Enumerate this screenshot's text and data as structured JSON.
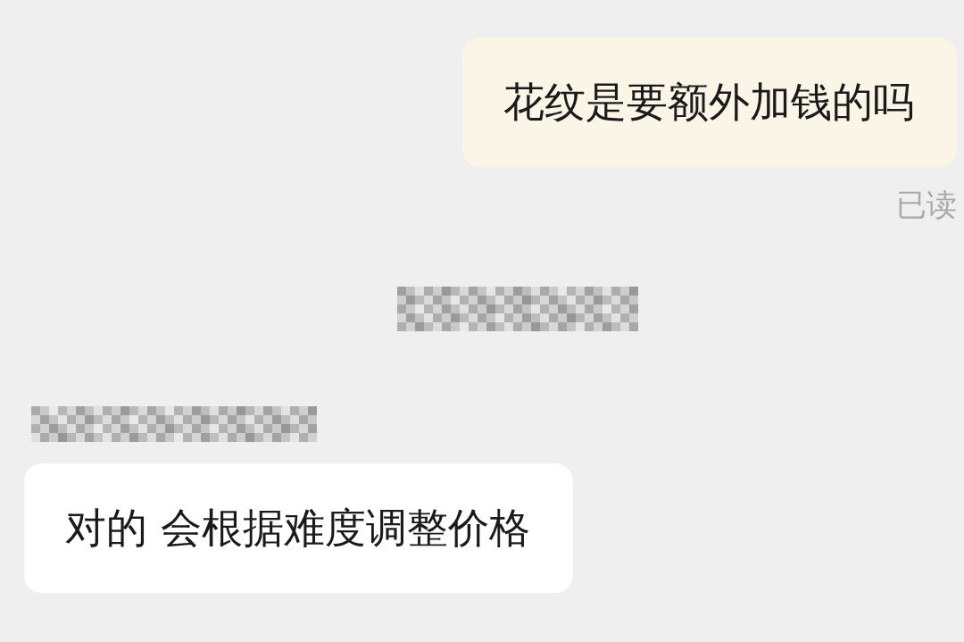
{
  "items": [
    {
      "kind": "sent",
      "text": "花纹是要额外加钱的吗",
      "receipt": "已读"
    },
    {
      "kind": "redacted-timestamp"
    },
    {
      "kind": "redacted-sender"
    },
    {
      "kind": "received",
      "text": "对的 会根据难度调整价格"
    }
  ]
}
